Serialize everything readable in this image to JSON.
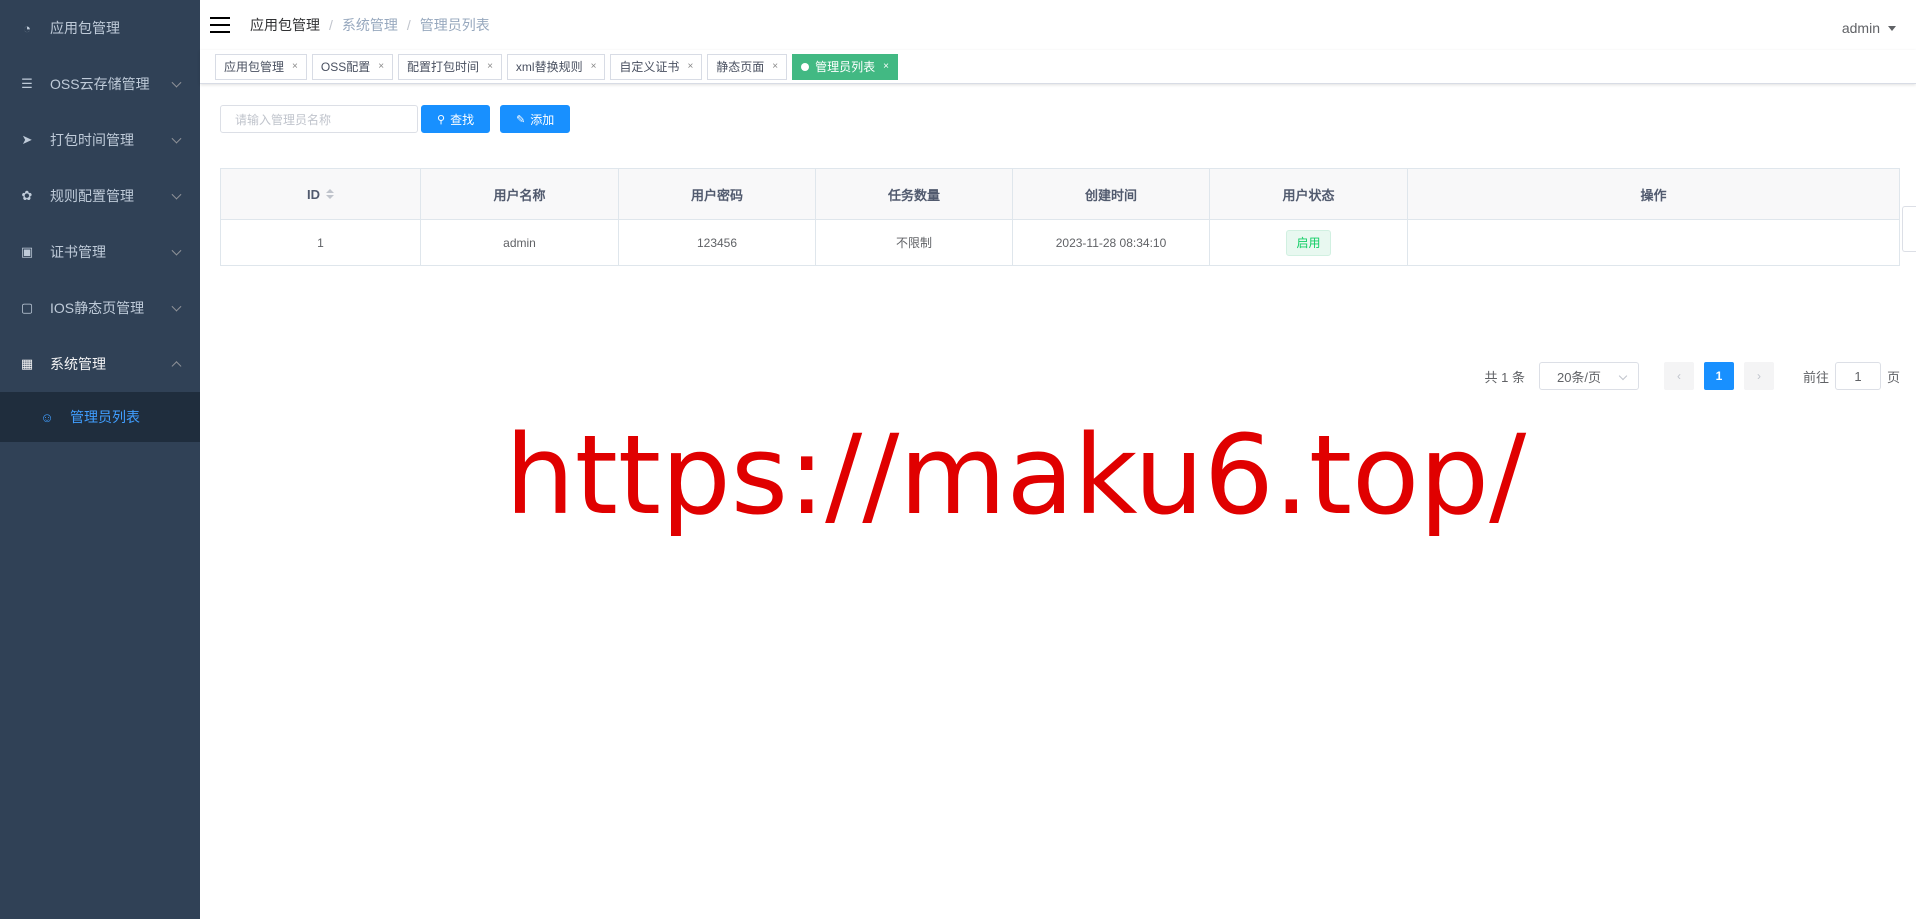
{
  "sidebar": {
    "items": [
      {
        "label": "应用包管理",
        "icon": "dashboard-icon",
        "glyph": "◔"
      },
      {
        "label": "OSS云存储管理",
        "icon": "list-icon",
        "glyph": "☰"
      },
      {
        "label": "打包时间管理",
        "icon": "send-icon",
        "glyph": "➤"
      },
      {
        "label": "规则配置管理",
        "icon": "gear-icon",
        "glyph": "✿"
      },
      {
        "label": "证书管理",
        "icon": "certificate-icon",
        "glyph": "▣"
      },
      {
        "label": "IOS静态页管理",
        "icon": "page-icon",
        "glyph": "▢"
      },
      {
        "label": "系统管理",
        "icon": "grid-icon",
        "glyph": "▦"
      }
    ],
    "subitems": [
      {
        "label": "管理员列表",
        "icon": "user-icon",
        "glyph": "☺"
      }
    ]
  },
  "header": {
    "breadcrumb": [
      "应用包管理",
      "系统管理",
      "管理员列表"
    ],
    "user": "admin"
  },
  "tags": [
    "应用包管理",
    "OSS配置",
    "配置打包时间",
    "xml替换规则",
    "自定义证书",
    "静态页面",
    "管理员列表"
  ],
  "toolbar": {
    "search_placeholder": "请输入管理员名称",
    "search_label": "查找",
    "add_label": "添加"
  },
  "table": {
    "columns": [
      "ID",
      "用户名称",
      "用户密码",
      "任务数量",
      "创建时间",
      "用户状态",
      "操作"
    ],
    "rows": [
      {
        "id": "1",
        "username": "admin",
        "password": "123456",
        "tasks": "不限制",
        "created": "2023-11-28 08:34:10",
        "status": "启用",
        "actions": ""
      }
    ]
  },
  "pagination": {
    "total": "共 1 条",
    "page_size": "20条/页",
    "current_page": "1",
    "goto_label": "前往",
    "goto_value": "1",
    "page_unit": "页"
  },
  "watermark": "https://maku6.top/",
  "colors": {
    "sidebar_bg": "#304156",
    "primary": "#1890ff",
    "active_tag": "#42b983",
    "watermark": "#e00000"
  }
}
